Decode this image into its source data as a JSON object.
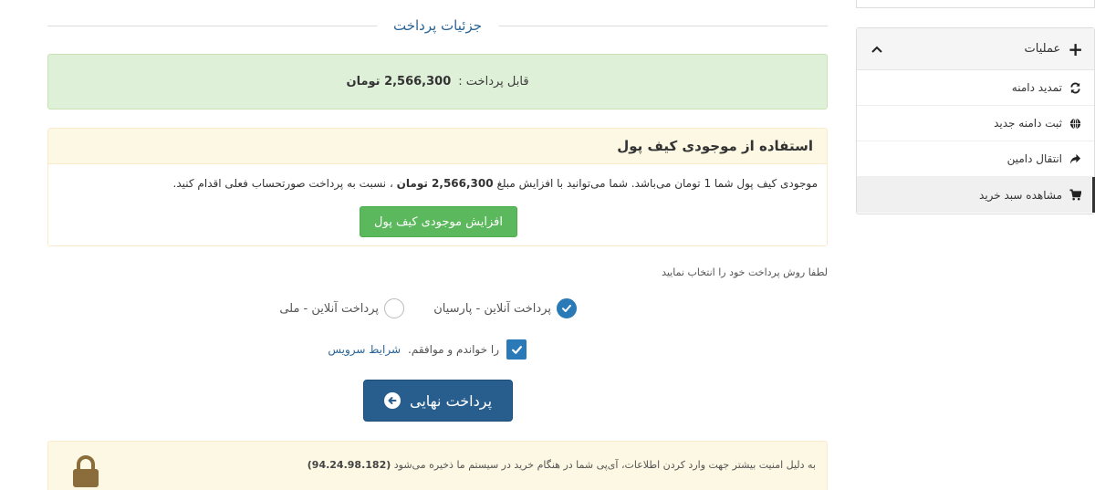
{
  "section_title": "جزئیات پرداخت",
  "payable": {
    "label": "قابل پرداخت :",
    "amount": "2,566,300 تومان"
  },
  "wallet": {
    "title": "استفاده از موجودی کیف پول",
    "text_part1": "موجودی کیف پول شما 1 تومان می‌باشد. شما می‌توانید با افزایش مبلغ",
    "text_amount": "2,566,300 تومان",
    "text_part2": "، نسبت به پرداخت صورتحساب فعلی اقدام کنید.",
    "button_label": "افزایش موجودی کیف پول"
  },
  "payment_methods": {
    "prompt": "لطفا روش پرداخت خود را انتخاب نمایید",
    "options": [
      {
        "label": "پرداخت آنلاین - پارسیان",
        "selected": true
      },
      {
        "label": "پرداخت آنلاین - ملی",
        "selected": false
      }
    ]
  },
  "terms": {
    "text": "را خواندم و موافقم.",
    "link": "شرایط سرویس",
    "checked": true
  },
  "final_button": "پرداخت نهایی",
  "security": {
    "text": "به دلیل امنیت بیشتر جهت وارد کردن اطلاعات، آی‌پی شما در هنگام خرید در سیستم ما ذخیره می‌شود",
    "ip": "(94.24.98.182)"
  },
  "sidebar": {
    "title": "عملیات",
    "items": [
      {
        "label": "تمدید دامنه",
        "icon": "refresh-icon"
      },
      {
        "label": "ثبت دامنه جدید",
        "icon": "globe-icon"
      },
      {
        "label": "انتقال دامین",
        "icon": "share-icon"
      },
      {
        "label": "مشاهده سبد خرید",
        "icon": "cart-icon"
      }
    ]
  },
  "colors": {
    "primary": "#285e8e",
    "success": "#5cb85c",
    "accent": "#2a7ab8",
    "warning_bg": "#fcf8e3",
    "success_bg": "#dff0d8"
  }
}
